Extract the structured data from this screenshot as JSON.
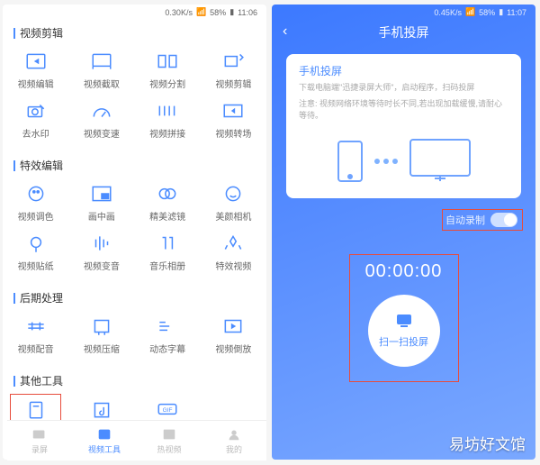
{
  "left": {
    "status": {
      "net": "0.30K/s",
      "batt": "58%",
      "time": "11:06"
    },
    "sections": [
      {
        "title": "视频剪辑",
        "items": [
          "视频编辑",
          "视频截取",
          "视频分割",
          "视频剪辑",
          "去水印",
          "视频变速",
          "视频拼接",
          "视频转场"
        ]
      },
      {
        "title": "特效编辑",
        "items": [
          "视频调色",
          "画中画",
          "精美滤镜",
          "美颜相机",
          "视频贴纸",
          "视频变音",
          "音乐相册",
          "特效视频"
        ]
      },
      {
        "title": "后期处理",
        "items": [
          "视频配音",
          "视频压缩",
          "动态字幕",
          "视频倒放"
        ]
      },
      {
        "title": "其他工具",
        "items": [
          "手机投屏",
          "提取音频",
          "转GIF"
        ]
      }
    ],
    "tabs": [
      "录屏",
      "视频工具",
      "热视频",
      "我的"
    ]
  },
  "right": {
    "status": {
      "net": "0.45K/s",
      "batt": "58%",
      "time": "11:07"
    },
    "title": "手机投屏",
    "card": {
      "title": "手机投屏",
      "line1": "下载电脑端\"迅捷录屏大师\"，启动程序，扫码投屏",
      "line2": "注意: 视频网络环境等待时长不同,若出现加载缓慢,请耐心等待。"
    },
    "toggle_label": "自动录制",
    "timer": "00:00:00",
    "scan_label": "扫一扫投屏"
  },
  "watermark": "易坊好文馆"
}
